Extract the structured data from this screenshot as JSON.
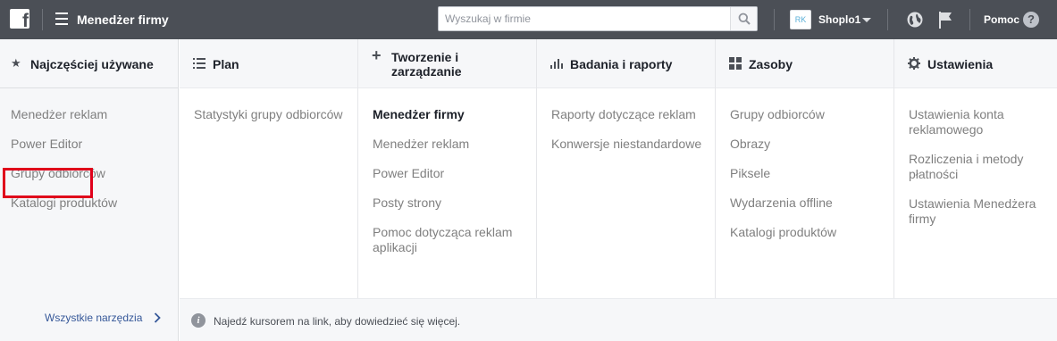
{
  "topbar": {
    "logo_letter": "f",
    "app_title": "Menedżer firmy",
    "search_placeholder": "Wyszukaj w firmie",
    "account_initials": "RK",
    "account_name": "Shoplo1",
    "help_label": "Pomoc",
    "help_icon_glyph": "?"
  },
  "columns": [
    {
      "header": "Najczęściej używane",
      "icon": "star-icon",
      "items": [
        "Menedżer reklam",
        "Power Editor",
        "Grupy odbiorców",
        "Katalogi produktów"
      ]
    },
    {
      "header": "Plan",
      "icon": "list-icon",
      "items": [
        "Statystyki grupy odbiorców"
      ]
    },
    {
      "header": "Tworzenie i zarządzanie",
      "icon": "plus-icon",
      "active_item": "Menedżer firmy",
      "items": [
        "Menedżer firmy",
        "Menedżer reklam",
        "Power Editor",
        "Posty strony",
        "Pomoc dotycząca reklam aplikacji"
      ]
    },
    {
      "header": "Badania i raporty",
      "icon": "bar-chart-icon",
      "items": [
        "Raporty dotyczące reklam",
        "Konwersje niestandardowe"
      ]
    },
    {
      "header": "Zasoby",
      "icon": "grid-icon",
      "items": [
        "Grupy odbiorców",
        "Obrazy",
        "Piksele",
        "Wydarzenia offline",
        "Katalogi produktów"
      ]
    },
    {
      "header": "Ustawienia",
      "icon": "gear-icon",
      "items": [
        "Ustawienia konta reklamowego",
        "Rozliczenia i metody płatności",
        "Ustawienia Menedżera firmy"
      ]
    }
  ],
  "footer": {
    "all_tools_link": "Wszystkie narzędzia",
    "hint_text": "Najedź kursorem na link, aby dowiedzieć się więcej.",
    "info_icon_glyph": "i"
  },
  "colors": {
    "topbar": "#4b4f56",
    "panel": "#f6f7f9",
    "highlight": "#e0001b",
    "link": "#365899"
  }
}
